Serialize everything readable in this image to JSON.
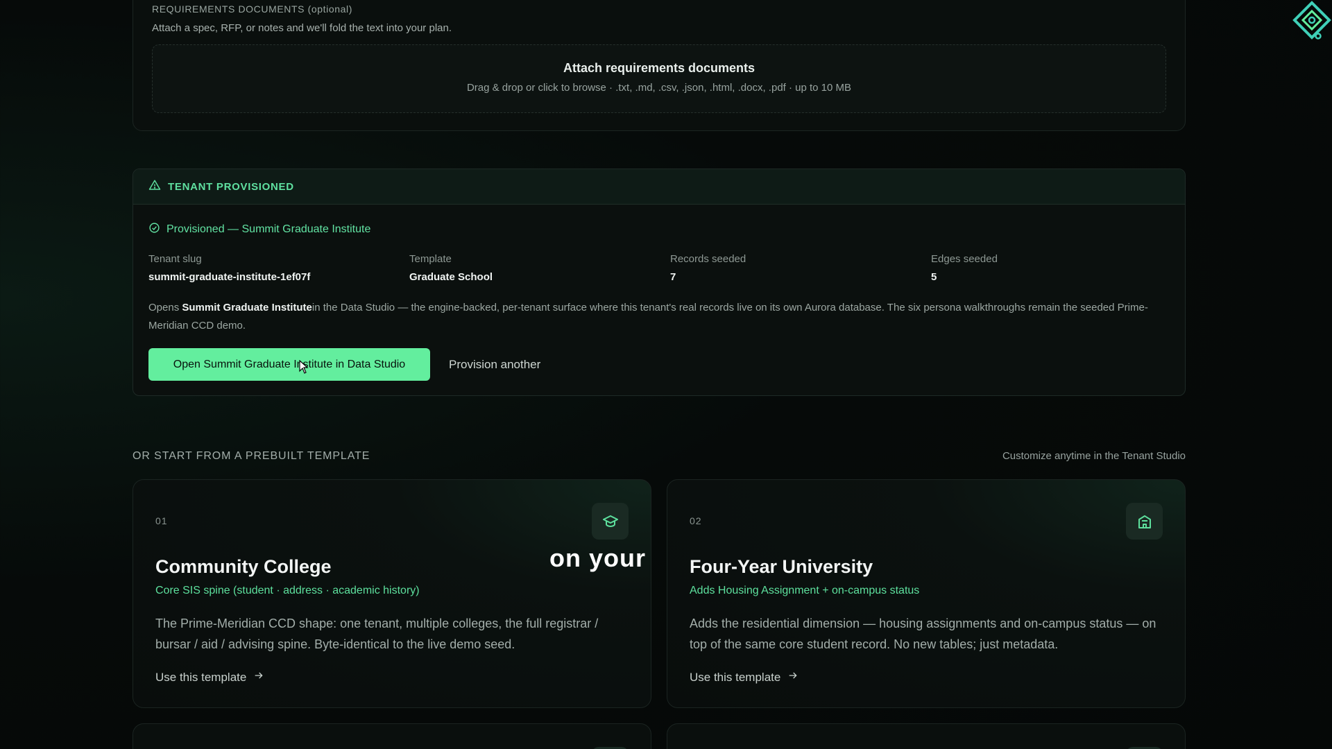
{
  "requirements": {
    "label": "REQUIREMENTS DOCUMENTS (optional)",
    "description": "Attach a spec, RFP, or notes and we'll fold the text into your plan.",
    "dropzone_title": "Attach requirements documents",
    "dropzone_sub": "Drag & drop or click to browse · .txt, .md, .csv, .json, .html, .docx, .pdf · up to 10 MB"
  },
  "tenant": {
    "header": "TENANT PROVISIONED",
    "provisioned_line": "Provisioned — Summit Graduate Institute",
    "meta": [
      {
        "key": "Tenant slug",
        "value": "summit-graduate-institute-1ef07f"
      },
      {
        "key": "Template",
        "value": "Graduate School"
      },
      {
        "key": "Records seeded",
        "value": "7"
      },
      {
        "key": "Edges seeded",
        "value": "5"
      }
    ],
    "desc_prefix": "Opens ",
    "desc_bold": "Summit Graduate Institute",
    "desc_rest": "in the Data Studio — the engine-backed, per-tenant surface where this tenant's real records live on its own Aurora database. The six persona walkthroughs remain the seeded Prime-Meridian CCD demo.",
    "primary_button": "Open Summit Graduate Institute in Data Studio",
    "secondary_button": "Provision another"
  },
  "templates": {
    "heading": "OR START FROM A PREBUILT TEMPLATE",
    "right_note": "Customize anytime in the Tenant Studio",
    "overlay_caption": "on your",
    "cards": [
      {
        "num": "01",
        "name": "Community College",
        "tag": "Core SIS spine (student · address · academic history)",
        "body": "The Prime-Meridian CCD shape: one tenant, multiple colleges, the full registrar / bursar / aid / advising spine. Byte-identical to the live demo seed.",
        "cta": "Use this template",
        "icon": "graduation-cap-icon"
      },
      {
        "num": "02",
        "name": "Four-Year University",
        "tag": "Adds Housing Assignment + on-campus status",
        "body": "Adds the residential dimension — housing assignments and on-campus status — on top of the same core student record. No new tables; just metadata.",
        "cta": "Use this template",
        "icon": "building-icon"
      }
    ]
  },
  "colors": {
    "accent": "#63ee9e",
    "accent_text": "#5fe0a0",
    "background": "#060a09"
  }
}
